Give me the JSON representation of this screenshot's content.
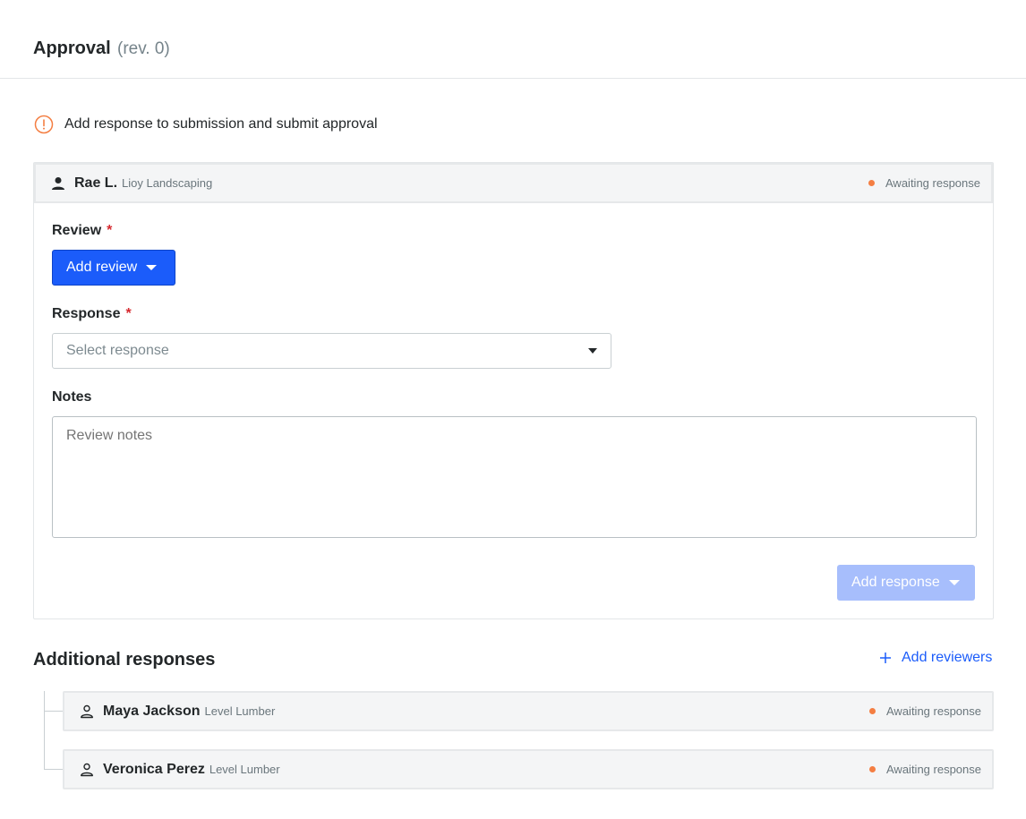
{
  "header": {
    "title": "Approval",
    "revision": "(rev. 0)"
  },
  "alert": {
    "icon": "exclamation-circle-icon",
    "text": "Add response to submission and submit approval"
  },
  "primary_reviewer": {
    "name": "Rae L.",
    "company": "Lioy Landscaping",
    "status": "Awaiting response",
    "icon": "person-filled-icon"
  },
  "form": {
    "review_label": "Review",
    "required_marker": "*",
    "add_review_button": "Add review",
    "response_label": "Response",
    "response_placeholder": "Select response",
    "notes_label": "Notes",
    "notes_placeholder": "Review notes",
    "add_response_button": "Add response"
  },
  "additional": {
    "title": "Additional responses",
    "add_reviewers_label": "Add reviewers",
    "reviewers": [
      {
        "name": "Maya Jackson",
        "company": "Level Lumber",
        "status": "Awaiting response"
      },
      {
        "name": "Veronica Perez",
        "company": "Level Lumber",
        "status": "Awaiting response"
      }
    ]
  },
  "colors": {
    "accent": "#1b5cfa",
    "accent_disabled": "#a7befc",
    "status_dot": "#f47e42",
    "alert": "#f47e42",
    "required": "#d6292e"
  }
}
